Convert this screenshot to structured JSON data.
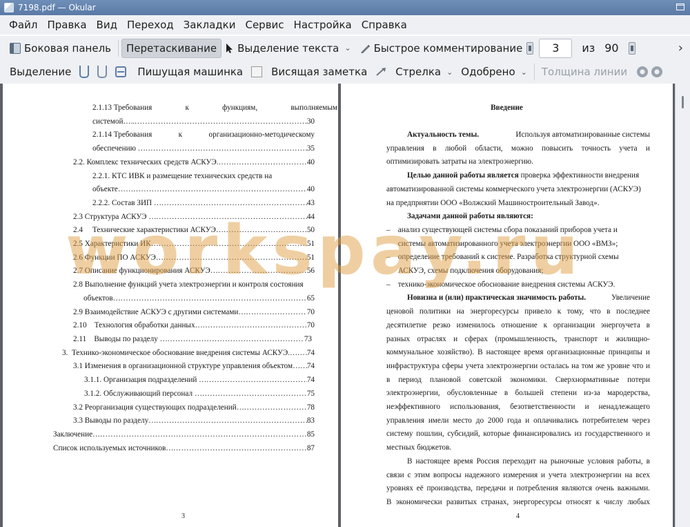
{
  "window": {
    "title": "7198.pdf  — Okular"
  },
  "menu": [
    "Файл",
    "Правка",
    "Вид",
    "Переход",
    "Закладки",
    "Сервис",
    "Настройка",
    "Справка"
  ],
  "toolbar1": {
    "sidebar": "Боковая панель",
    "drag": "Перетаскивание",
    "text_select": "Выделение текста",
    "quick_comment": "Быстрое комментирование",
    "page_current": "3",
    "page_of": "из",
    "page_total": "90",
    "overflow": "›"
  },
  "toolbar2": {
    "selection": "Выделение",
    "typewriter": "Пишущая машинка",
    "sticky_note": "Висящая заметка",
    "arrow": "Стрелка",
    "approved": "Одобрено",
    "line_width": "Толщина линии"
  },
  "page_left": {
    "number": "3",
    "toc": [
      {
        "a": "2.1.13 Требования",
        "b": "к",
        "c": "функциям,",
        "d": "выполняемым"
      },
      {
        "text": "системой…..",
        "page": "30"
      },
      {
        "a": "2.1.14 Требования",
        "b": "к",
        "c": "организационно-методическому"
      },
      {
        "text": "обеспечению …",
        "page": "35"
      },
      {
        "text": "2.2. Комплекс технических средств АСКУЭ.……",
        "page": "40"
      },
      {
        "a": "2.2.1.  КТС  ИВК  и  размещение  технических  средств  на"
      },
      {
        "text": "объекте……",
        "page": "40"
      },
      {
        "text": "2.2.2. Состав ЗИП …",
        "page": "43"
      },
      {
        "text": "2.3 Структура АСКУЭ …",
        "page": "44"
      },
      {
        "text": "2.4     Технические характеристики АСКУЭ…",
        "page": "50"
      },
      {
        "text": "2.5 Характеристики ИК…",
        "page": "51"
      },
      {
        "text": "2.6 Функции ПО АСКУЭ…",
        "page": "51"
      },
      {
        "text": "2.7 Описание функционирования АСКУЭ…",
        "page": "56"
      },
      {
        "a": "2.8 Выполнение функций учета электроэнергии и контроля состояния"
      },
      {
        "text": "объектов…",
        "page": "65"
      },
      {
        "text": "2.9 Взаимодействие АСКУЭ с другими системами…",
        "page": "70"
      },
      {
        "text": "2.10    Технология обработки данных…",
        "page": "70"
      },
      {
        "text": "2.11    Выводы по разделу …",
        "page": "73"
      },
      {
        "text": "3.  Технико-экономическое обоснование внедрения системы АСКУЭ.…",
        "page": "74"
      },
      {
        "text": "3.1 Изменения в организационной структуре управления объектом…",
        "page": "74"
      },
      {
        "text": "3.1.1. Организация подразделений …",
        "page": "74"
      },
      {
        "text": "3.1.2. Обслуживающий персонал …",
        "page": "75"
      },
      {
        "text": "3.2 Реорганизация существующих подразделений…",
        "page": "78"
      },
      {
        "text": "3.3 Выводы по разделу…",
        "page": "83"
      },
      {
        "text": "Заключение…",
        "page": "85"
      },
      {
        "text": "Список используемых источников…",
        "page": "87"
      }
    ]
  },
  "page_right": {
    "number": "4",
    "heading": "Введение",
    "lines": [
      {
        "bold": "Актуальность  темы.",
        "rest": "  Используя  автоматизированные  системы",
        "indent": true,
        "justify": true
      },
      {
        "text": "управления  в  любой  области,  можно  повысить  точность  учета  и",
        "justify": true
      },
      {
        "text": "оптимизировать затраты на электроэнергию."
      },
      {
        "bold": "Целью данной работы является",
        "rest": " проверка эффективности внедрения",
        "indent": true
      },
      {
        "text": "автоматизированной системы коммерческого учета электроэнергии (АСКУЭ)"
      },
      {
        "text": "на предприятии ООО «Волжский Машиностроительный Завод»."
      },
      {
        "bold": "Задачами данной работы являются:",
        "rest": "",
        "indent": true
      },
      {
        "text": "–    анализ существующей системы сбора показаний приборов учета и"
      },
      {
        "text": "      системы автоматизированного учета электроэнергии ООО «ВМЗ»;"
      },
      {
        "text": "–    определение требований к системе. Разработка структурной схемы"
      },
      {
        "text": "      АСКУЭ, схемы подключения оборудования;"
      },
      {
        "text": "–    технико-экономическое обоснование внедрения системы АСКУЭ."
      },
      {
        "bold": "Новизна  и  (или)  практическая  значимость  работы.",
        "rest": " Увеличение",
        "indent": true,
        "justify": true
      },
      {
        "text": "ценовой  политики  на  энергоресурсы  привело  к  тому,  что  в  последнее",
        "justify": true
      },
      {
        "text": "десятилетие  резко  изменилось  отношение  к  организации  энергоучета  в",
        "justify": true
      },
      {
        "text": "разных  отраслях  и  сферах  (промышленность,  транспорт  и  жилищно-",
        "justify": true
      },
      {
        "text": "коммунальное хозяйство). В настоящее время организационные принципы и",
        "justify": true
      },
      {
        "text": "инфраструктура сферы учета электроэнергии осталась на том же уровне что и",
        "justify": true
      },
      {
        "text": "в  период  плановой  советской  экономики.  Сверхнормативные  потери",
        "justify": true
      },
      {
        "text": "электроэнергии,  обусловленные  в  большей  степени  из-за  мародерства,",
        "justify": true
      },
      {
        "text": "неэффективного  использования,  безответственности  и  ненадлежащего",
        "justify": true
      },
      {
        "text": "управления имели место до 2000 года и оплачивались потребителем через",
        "justify": true
      },
      {
        "text": "систему пошлин, субсидий, которые финансировались из государственного и",
        "justify": true
      },
      {
        "text": "местных бюджетов."
      },
      {
        "text": "В настоящее время Россия переходит на рыночные условия работы, в",
        "indent": true,
        "justify": true
      },
      {
        "text": "связи с этим вопросы надежного измерения и учета электроэнергии на всех",
        "justify": true
      },
      {
        "text": "уровнях её производства, передачи и потребления являются очень важными.",
        "justify": true
      },
      {
        "text": "В экономически развитых странах, энергоресурсы относят к числу любых",
        "justify": true
      }
    ]
  },
  "watermark": "workspay.ru",
  "colors": {
    "titlebar": "#5a7aa6",
    "toolbar_bg": "#eef0f3",
    "viewport_bg": "#5d6066",
    "watermark": "#dfa046"
  },
  "icons": [
    "app-icon",
    "maximize-icon",
    "sidebar-panel-icon",
    "cursor-icon",
    "pen-icon",
    "page-up-icon",
    "page-down-icon",
    "underline-icon",
    "squiggle-icon",
    "strikeout-icon",
    "note-icon",
    "arrow-icon",
    "gear-icon"
  ]
}
